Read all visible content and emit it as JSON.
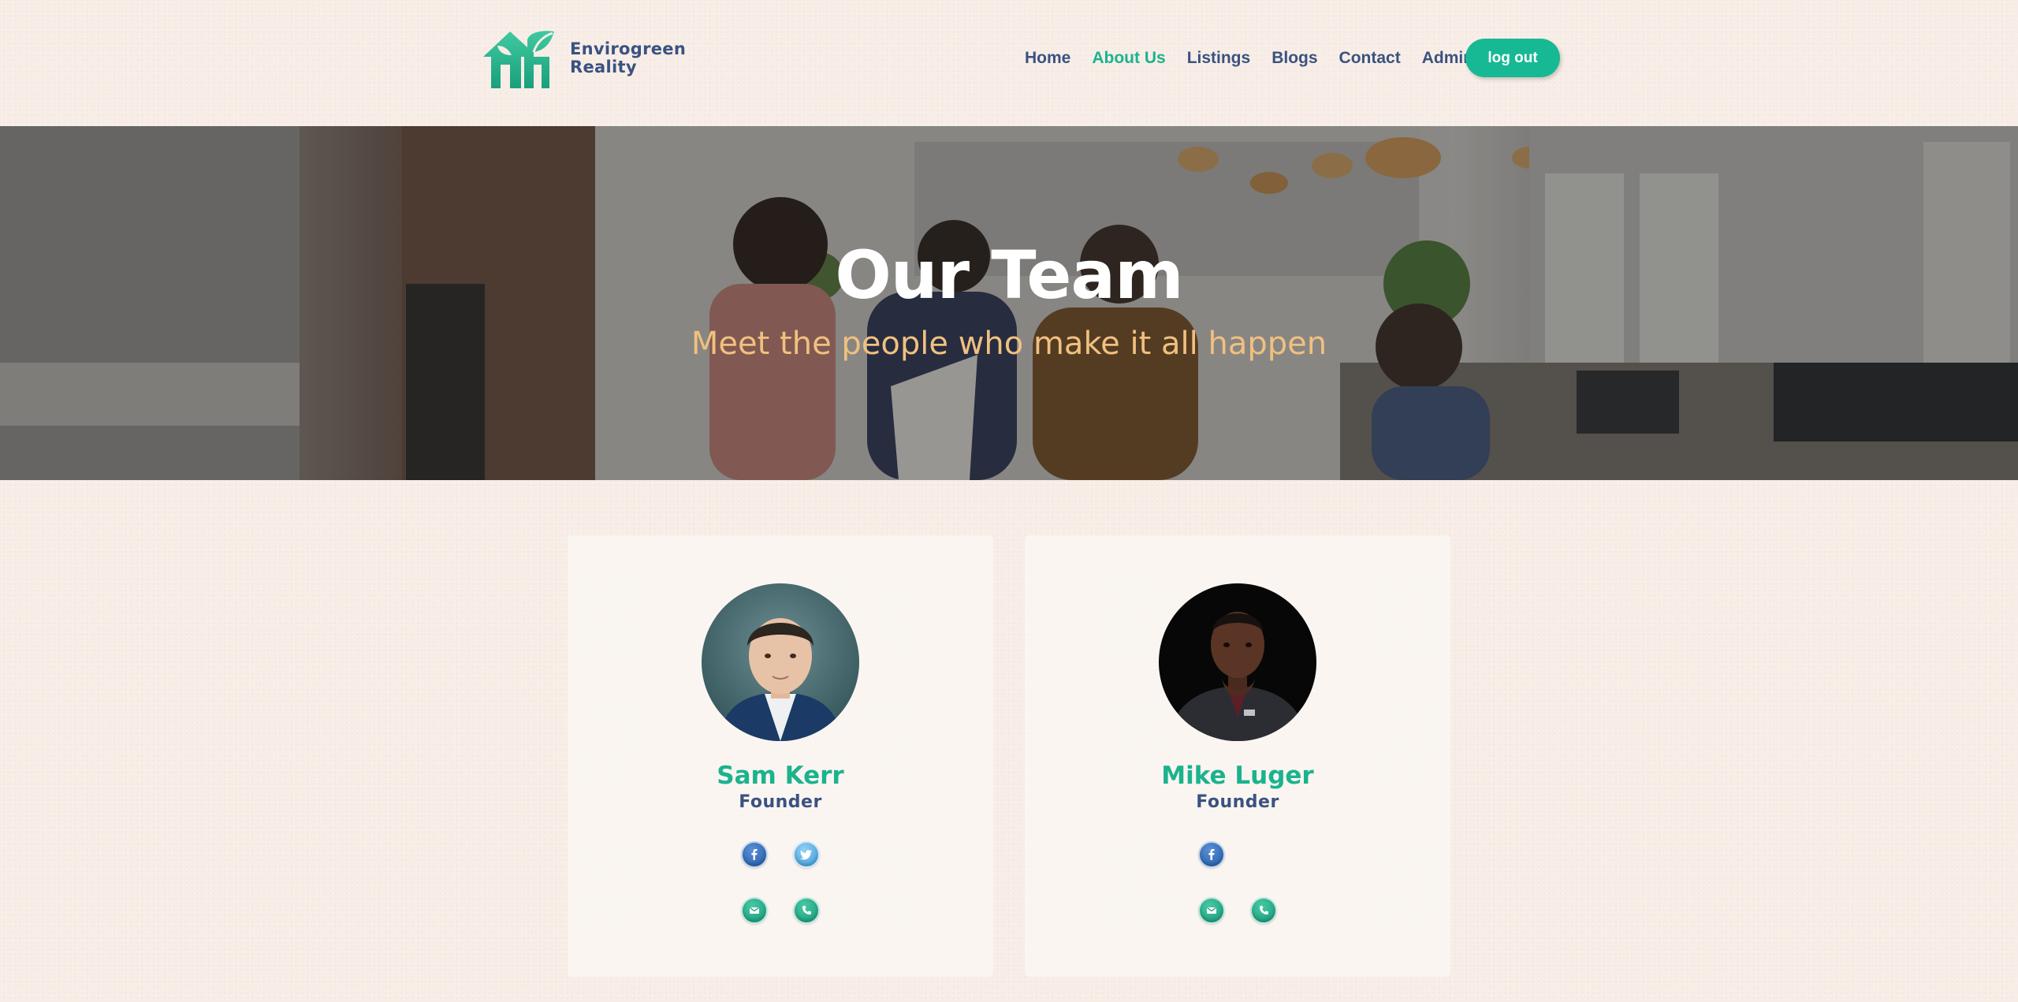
{
  "brand": {
    "name_line1": "Envirogreen",
    "name_line2": "Reality",
    "primary_color": "#1bb38e",
    "text_color": "#3a5280"
  },
  "nav": {
    "items": [
      {
        "label": "Home",
        "active": false
      },
      {
        "label": "About Us",
        "active": true
      },
      {
        "label": "Listings",
        "active": false
      },
      {
        "label": "Blogs",
        "active": false
      },
      {
        "label": "Contact",
        "active": false
      },
      {
        "label": "Admin",
        "active": false
      }
    ],
    "logout_label": "log out"
  },
  "hero": {
    "title": "Our Team",
    "subtitle": "Meet the people who make it all happen",
    "subtitle_color": "#f1c07f"
  },
  "team": [
    {
      "name": "Sam Kerr",
      "role": "Founder",
      "socials": [
        "facebook-icon",
        "twitter-icon"
      ],
      "contacts": [
        "email-icon",
        "phone-icon"
      ]
    },
    {
      "name": "Mike Luger",
      "role": "Founder",
      "socials": [
        "facebook-icon"
      ],
      "contacts": [
        "email-icon",
        "phone-icon"
      ]
    }
  ]
}
